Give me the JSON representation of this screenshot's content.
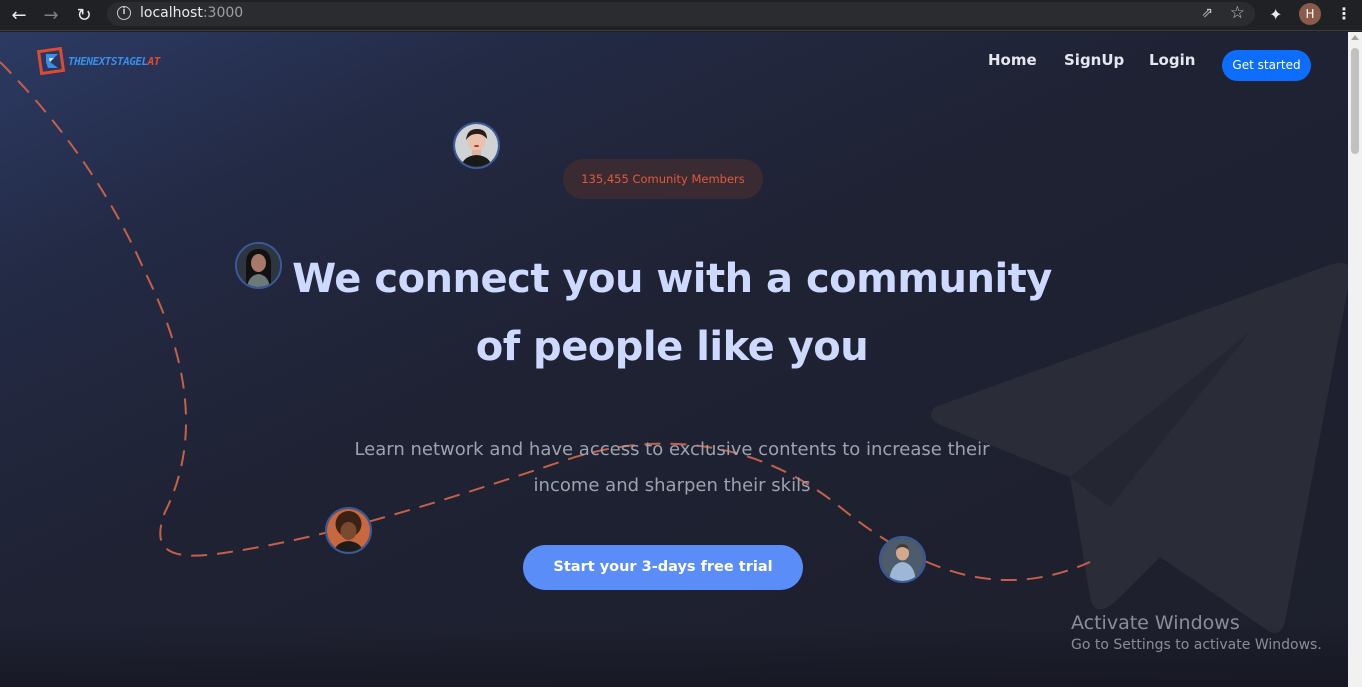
{
  "browser": {
    "url_host": "localhost",
    "url_port": ":3000",
    "profile_initial": "H",
    "icons": [
      "back-arrow-icon",
      "forward-arrow-icon",
      "reload-icon",
      "info-icon",
      "share-icon",
      "star-icon",
      "extensions-icon",
      "menu-icon"
    ]
  },
  "brand": {
    "logo_text_main": "THENEXTSTAGEL",
    "logo_text_accent": "AT",
    "colors": {
      "blue": "#3a8ee8",
      "red": "#e04a32"
    }
  },
  "nav": {
    "items": [
      {
        "label": "Home"
      },
      {
        "label": "SignUp"
      },
      {
        "label": "Login"
      }
    ],
    "cta_label": "Get started",
    "cta_color": "#0d6efd"
  },
  "hero": {
    "badge": "135,455 Comunity Members",
    "headline_line1": "We connect you with a community",
    "headline_line2": "of people like you",
    "sub_line1": "Learn network and have access to exclusive contents to increase their",
    "sub_line2": "income and sharpen their skils",
    "cta_label": "Start your 3-days free trial",
    "accent_color": "#5a8df7",
    "headline_color": "#cdd9ff"
  },
  "avatars": [
    "avatar-woman-short-hair",
    "avatar-woman-dark-hair",
    "avatar-man-curly-hair",
    "avatar-man-blue-shirt"
  ],
  "os_watermark": {
    "title": "Activate Windows",
    "subtitle": "Go to Settings to activate Windows."
  }
}
